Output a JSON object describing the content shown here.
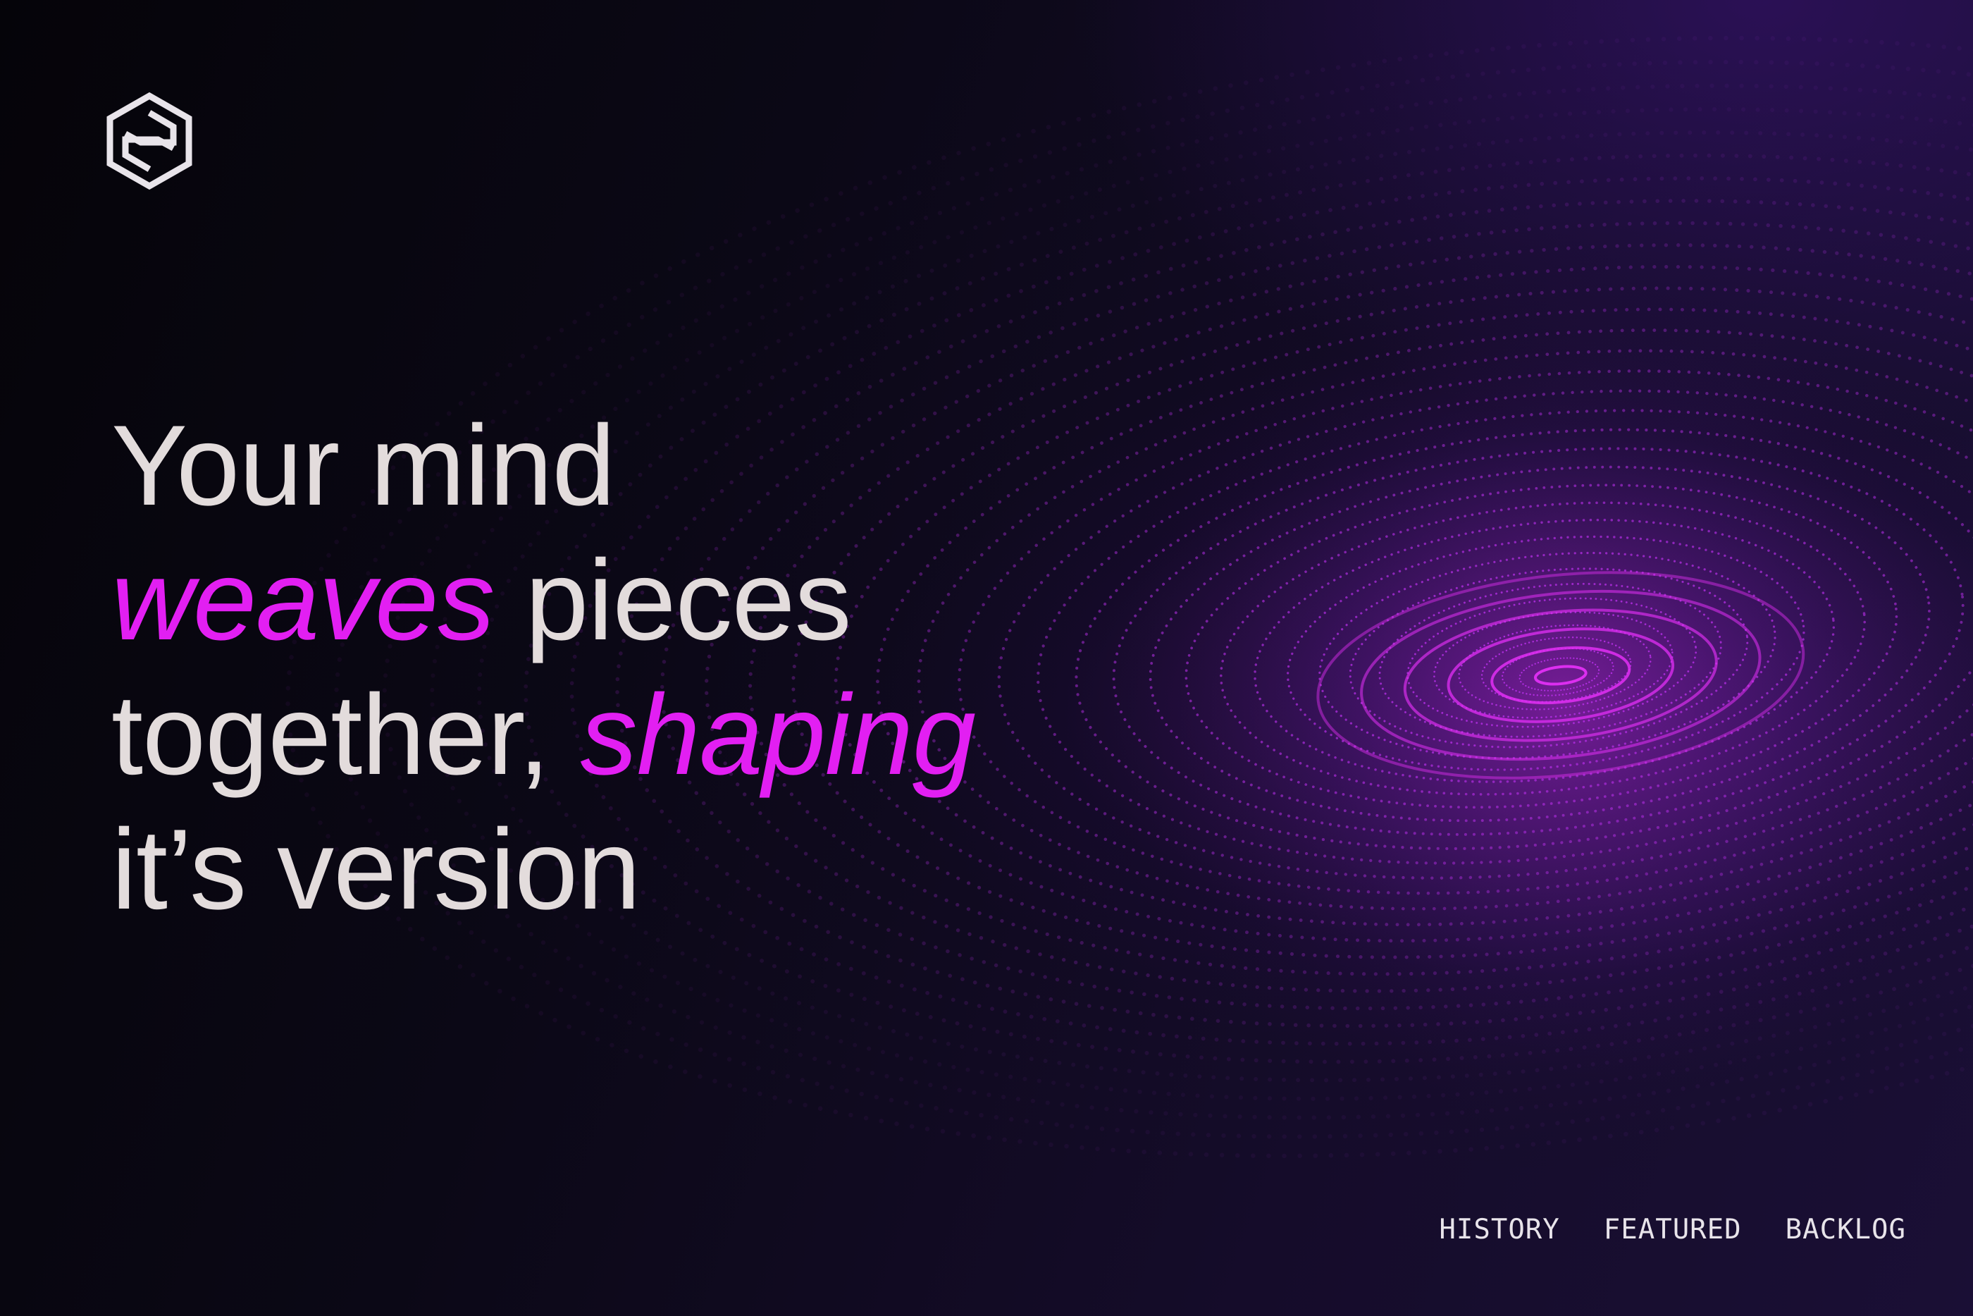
{
  "colors": {
    "background": "#07060c",
    "text": "#e3dcdc",
    "accent": "#e21ff2",
    "wave": "#b52fe6"
  },
  "logo": {
    "icon": "hexagon-weave-logo-icon"
  },
  "hero": {
    "line1": "Your mind",
    "accent1": "weaves",
    "line2_rest": " pieces",
    "line3_start": "together, ",
    "accent2": "shaping",
    "line4": "it’s version"
  },
  "nav": {
    "history": "HISTORY",
    "featured": "FEATURED",
    "backlog": "BACKLOG"
  }
}
